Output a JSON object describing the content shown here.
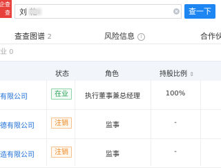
{
  "header": {
    "logo_line1": "企查",
    "logo_line2": "查",
    "search_value": "刘 乾",
    "search_button": "查一下"
  },
  "tabs": [
    {
      "label": "查查图谱",
      "count": "2"
    },
    {
      "label": "风险信息",
      "info_icon": "i"
    },
    {
      "label": "合作伙"
    }
  ],
  "sub_info": "业 0",
  "table": {
    "headers": {
      "status": "状态",
      "role": "角色",
      "ratio": "持股比例",
      "ratio_sort_icon": "⇕"
    },
    "rows": [
      {
        "company": "有限公司",
        "status": "在业",
        "status_type": "active",
        "role": "执行董事兼总经理",
        "ratio": "100%"
      },
      {
        "company": "德有限公司",
        "status": "注销",
        "status_type": "cancel",
        "role": "监事",
        "ratio": "-"
      },
      {
        "company": "造有限公司",
        "status": "注销",
        "status_type": "cancel",
        "role": "监事",
        "ratio": "-"
      }
    ]
  },
  "colors": {
    "accent": "#1e86f2",
    "active": "#2ca05a",
    "cancel": "#f08a24",
    "logo": "#e8413c"
  }
}
